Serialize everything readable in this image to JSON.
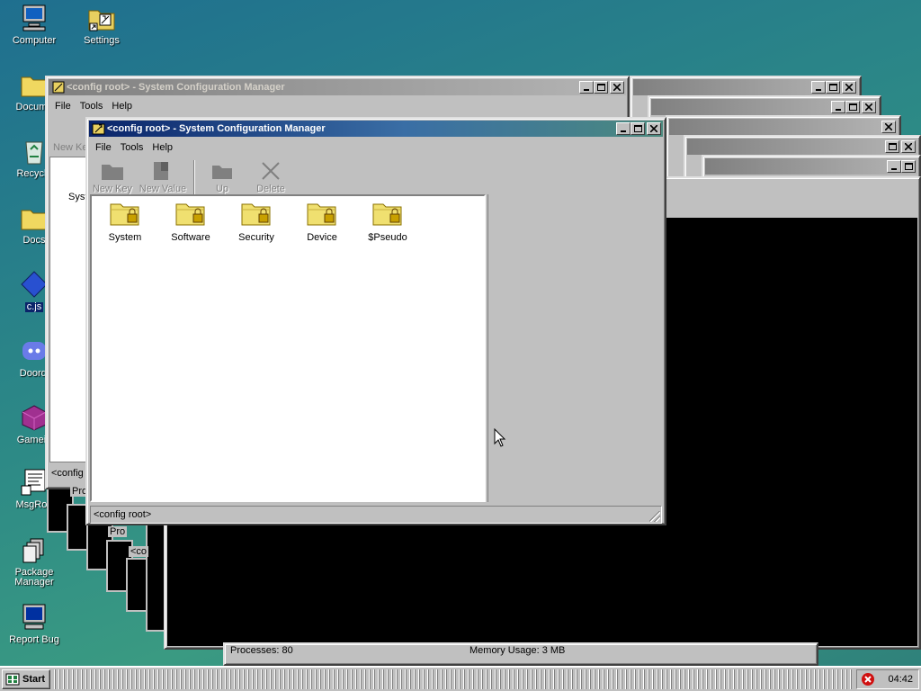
{
  "desktop": {
    "icons": [
      {
        "label": "Computer",
        "name": "computer"
      },
      {
        "label": "Settings",
        "name": "settings"
      },
      {
        "label": "Docume",
        "name": "documents"
      },
      {
        "label": "Recycle",
        "name": "recycle-bin"
      },
      {
        "label": "Docs",
        "name": "docs"
      },
      {
        "label": "c.js",
        "name": "cjs-file"
      },
      {
        "label": "Doordi",
        "name": "discord"
      },
      {
        "label": "Gamein",
        "name": "games"
      },
      {
        "label": "MsgRoo",
        "name": "msgroom"
      },
      {
        "label": "Package Manager",
        "name": "package-manager"
      },
      {
        "label": "Report Bug",
        "name": "report-bug"
      }
    ]
  },
  "background_window": {
    "title": "<config root> - System Configuration Manager",
    "menu": [
      "File",
      "Tools",
      "Help"
    ],
    "toolbar_partial": "New Ke",
    "folder_partial": "Syst",
    "status_partial": "<config"
  },
  "stacked_fragments": {
    "proc_label_1": "Pro",
    "proc_label_2": "Pro",
    "config_label": "<co",
    "processes_text": "Processes: 80",
    "memory_text": "Memory Usage: 3 MB"
  },
  "main_window": {
    "title": "<config root> - System Configuration Manager",
    "menu": [
      "File",
      "Tools",
      "Help"
    ],
    "toolbar": [
      {
        "label": "New Key",
        "icon": "folder-icon"
      },
      {
        "label": "New Value",
        "icon": "document-icon"
      },
      {
        "label": "Up",
        "icon": "folder-up-icon"
      },
      {
        "label": "Delete",
        "icon": "delete-icon"
      }
    ],
    "folders": [
      "System",
      "Software",
      "Security",
      "Device",
      "$Pseudo"
    ],
    "status": "<config root>"
  },
  "taskbar": {
    "start_label": "Start",
    "clock": "04:42"
  },
  "colors": {
    "titlebar_active": "#0a246a",
    "window_face": "#c0c0c0",
    "desktop": "#2d8a86"
  }
}
